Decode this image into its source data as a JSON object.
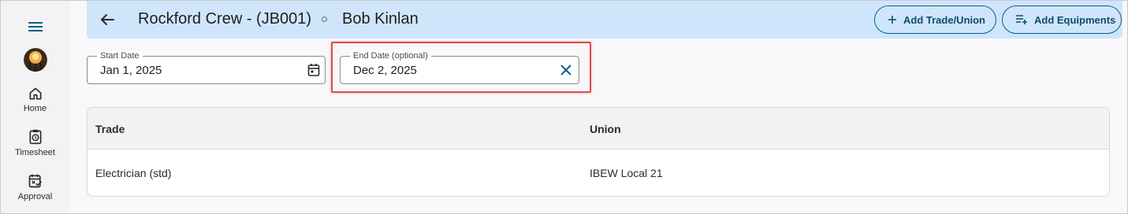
{
  "sidebar": {
    "items": [
      {
        "label": "Home",
        "icon": "home-icon"
      },
      {
        "label": "Timesheet",
        "icon": "timesheet-icon"
      },
      {
        "label": "Approval",
        "icon": "approval-icon"
      }
    ]
  },
  "header": {
    "title": "Rockford Crew - (JB001)",
    "person": "Bob Kinlan",
    "add_trade_label": "Add Trade/Union",
    "add_equipments_label": "Add Equipments"
  },
  "filters": {
    "start_date": {
      "label": "Start Date",
      "value": "Jan 1, 2025"
    },
    "end_date": {
      "label": "End Date (optional)",
      "value": "Dec 2, 2025"
    }
  },
  "table": {
    "columns": [
      "Trade",
      "Union"
    ],
    "rows": [
      [
        "Electrician (std)",
        "IBEW Local 21"
      ]
    ]
  },
  "colors": {
    "accent": "#0d5f84",
    "header_bg": "#cfe5fb",
    "highlight": "#e24a4a"
  }
}
